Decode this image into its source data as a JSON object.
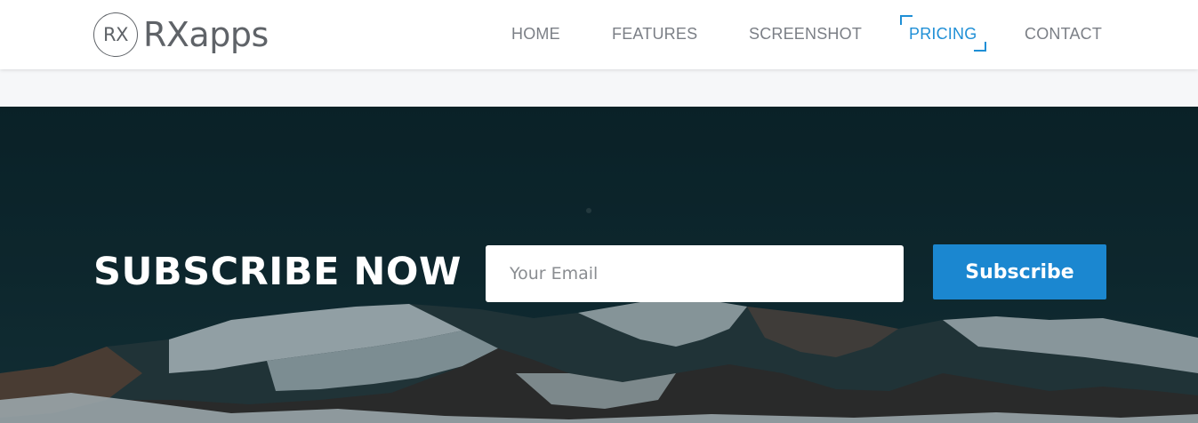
{
  "brand": {
    "badge_text": "RX",
    "name": "RXapps"
  },
  "nav": {
    "items": [
      {
        "label": "HOME"
      },
      {
        "label": "FEATURES"
      },
      {
        "label": "SCREENSHOT"
      },
      {
        "label": "PRICING",
        "active": true
      },
      {
        "label": "CONTACT"
      }
    ]
  },
  "subscribe": {
    "heading": "SUBSCRIBE NOW",
    "email_placeholder": "Your Email",
    "email_value": "",
    "button_label": "Subscribe"
  },
  "colors": {
    "accent": "#1b87d0",
    "nav_text": "#7b7f86",
    "section_bg": "#0a2127"
  }
}
